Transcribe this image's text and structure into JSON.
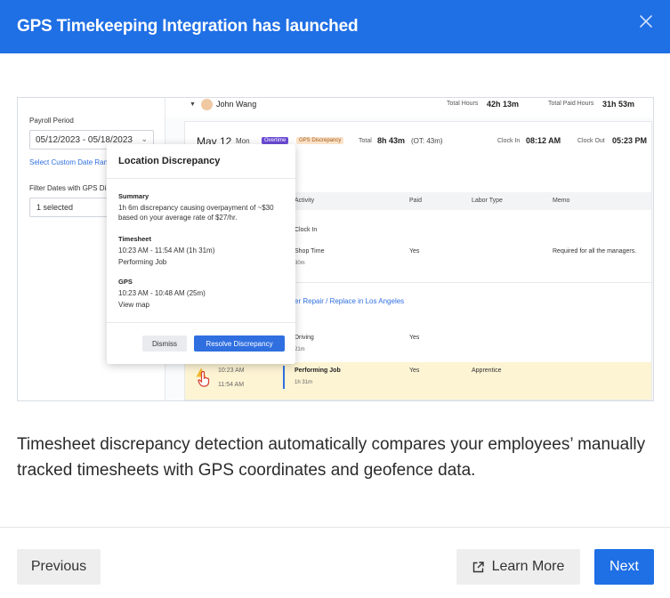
{
  "modal": {
    "title": "GPS Timekeeping Integration has launched",
    "description": "Timesheet discrepancy detection automatically compares your employees’ manually tracked timesheets with GPS coordinates and geofence data."
  },
  "footer": {
    "previous_label": "Previous",
    "learn_more_label": "Learn More",
    "next_label": "Next"
  },
  "preview": {
    "left_panel": {
      "payroll_period_label": "Payroll Period",
      "date_range": "05/12/2023 - 05/18/2023",
      "custom_range_link": "Select Custom Date Rang",
      "filter_label": "Filter Dates with GPS Di",
      "filter_value": "1 selected"
    },
    "employee": {
      "name": "John Wang",
      "total_hours_label": "Total Hours",
      "total_hours": "42h 13m",
      "total_paid_label": "Total Paid Hours",
      "total_paid": "31h 53m"
    },
    "day": {
      "date": "May 12",
      "weekday": "Mon",
      "tag_overtime": "Overtime",
      "tag_gps": "GPS Discrepancy",
      "total_label": "Total",
      "total_value": "8h 43m",
      "ot_value": "(OT: 43m)",
      "clock_in_label": "Clock In",
      "clock_in": "08:12 AM",
      "clock_out_label": "Clock Out",
      "clock_out": "05:23 PM"
    },
    "table": {
      "headers": [
        "Activity",
        "Paid",
        "Labor Type",
        "Memo"
      ],
      "rows": [
        {
          "activity": "Clock In",
          "sub": "",
          "paid": "",
          "labor": "",
          "memo": ""
        },
        {
          "activity": "Shop Time",
          "sub": "30m",
          "paid": "Yes",
          "labor": "",
          "memo": "Required for all the managers."
        },
        {
          "activity": "er Repair / Replace in Los Angeles",
          "sub": "",
          "paid": "",
          "labor": "",
          "memo": ""
        },
        {
          "activity": "Driving",
          "sub": "21m",
          "paid": "Yes",
          "labor": "",
          "memo": ""
        },
        {
          "activity": "Performing Job",
          "sub": "1h 31m",
          "paid": "Yes",
          "labor": "Apprentice",
          "memo": ""
        }
      ],
      "highlight_start": "10:23 AM",
      "highlight_end": "11:54 AM"
    },
    "popover": {
      "title": "Location Discrepancy",
      "summary_heading": "Summary",
      "summary_text": "1h 6m discrepancy causing overpayment of ~$30 based on your average rate of $27/hr.",
      "timesheet_heading": "Timesheet",
      "timesheet_time": "10:23 AM - 11:54 AM (1h 31m)",
      "timesheet_activity": "Performing Job",
      "gps_heading": "GPS",
      "gps_time": "10:23 AM - 10:48 AM (25m)",
      "view_map": "View map",
      "dismiss_label": "Dismiss",
      "resolve_label": "Resolve Discrepancy"
    }
  },
  "colors": {
    "header_bg": "#1f6fe5",
    "next_bg": "#1f6fe5",
    "secondary_bg": "#eeeeee",
    "overtime_tag": "#6b4bd6",
    "gps_tag": "#fbe3c8",
    "highlight_row": "#fdf4d4"
  },
  "icons": {
    "close": "close-icon",
    "external_link": "external-link-icon",
    "warning": "warning-icon"
  }
}
